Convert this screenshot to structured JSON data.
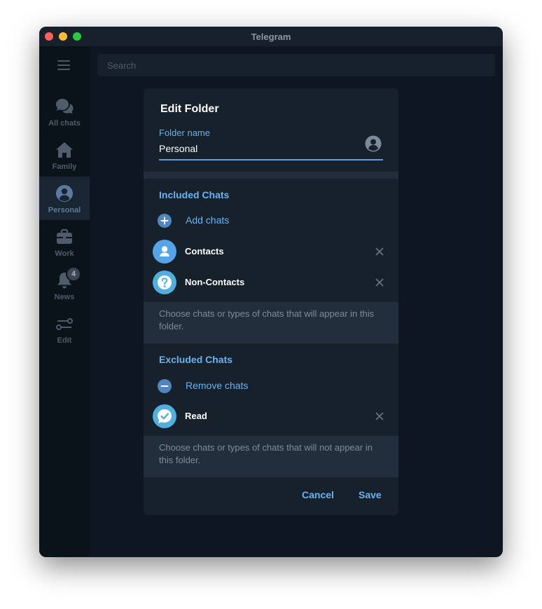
{
  "window": {
    "title": "Telegram"
  },
  "search": {
    "placeholder": "Search"
  },
  "sidebar": {
    "folders": [
      {
        "label": "All chats",
        "icon": "chats-icon"
      },
      {
        "label": "Family",
        "icon": "house-icon"
      },
      {
        "label": "Personal",
        "icon": "person-icon",
        "active": true
      },
      {
        "label": "Work",
        "icon": "briefcase-icon"
      },
      {
        "label": "News",
        "icon": "bell-icon",
        "badge": "4"
      },
      {
        "label": "Edit",
        "icon": "sliders-icon"
      }
    ]
  },
  "dialog": {
    "title": "Edit Folder",
    "folder_name_label": "Folder name",
    "folder_name_value": "Personal",
    "included": {
      "title": "Included Chats",
      "add_label": "Add chats",
      "items": [
        {
          "name": "Contacts",
          "icon": "person-icon",
          "color": "#55a3e8"
        },
        {
          "name": "Non-Contacts",
          "icon": "question-icon",
          "color": "#4fb0e0"
        }
      ],
      "hint": "Choose chats or types of chats that will appear in this folder."
    },
    "excluded": {
      "title": "Excluded Chats",
      "remove_label": "Remove chats",
      "items": [
        {
          "name": "Read",
          "icon": "check-bubble-icon",
          "color": "#4fb0e0"
        }
      ],
      "hint": "Choose chats or types of chats that will not appear in this folder."
    },
    "cancel_label": "Cancel",
    "save_label": "Save"
  },
  "colors": {
    "accent": "#6ab3f3",
    "dialog_bg": "#17212b",
    "window_bg": "#0e1621",
    "sidebar_bg": "#0a121a"
  }
}
